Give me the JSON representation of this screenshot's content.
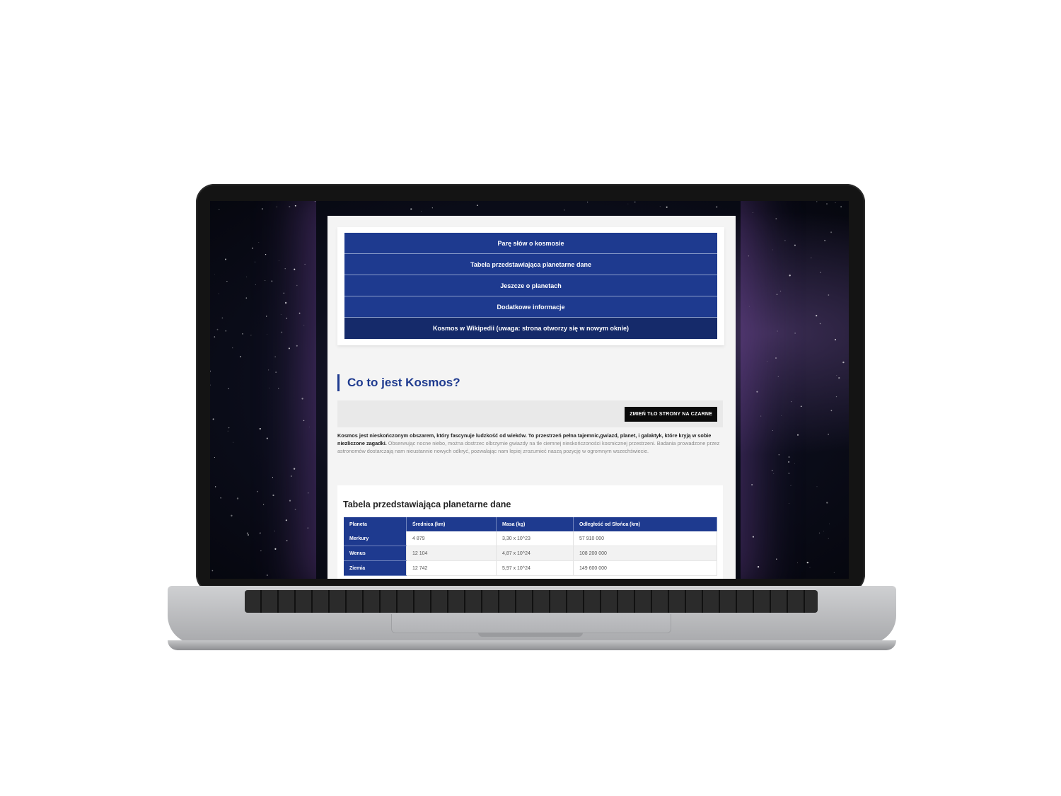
{
  "nav": {
    "items": [
      {
        "label": "Parę słów o kosmosie"
      },
      {
        "label": "Tabela przedstawiająca planetarne dane"
      },
      {
        "label": "Jeszcze o planetach"
      },
      {
        "label": "Dodatkowe informacje"
      },
      {
        "label": "Kosmos w Wikipedii (uwaga: strona otworzy się w nowym oknie)"
      }
    ]
  },
  "section": {
    "heading": "Co to jest Kosmos?",
    "bg_button": "ZMIEŃ TŁO STRONY NA CZARNE",
    "intro_bold": "Kosmos jest nieskończonym obszarem, który fascynuje ludzkość od wieków. To przestrzeń pełna tajemnic,gwiazd, planet, i galaktyk, które kryją w sobie niezliczone zagadki.",
    "intro_text": "Obserwując nocne niebo, można dostrzec olbrzymie gwiazdy na tle ciemnej nieskończoności kosmicznej przestrzeni. Badania prowadzone przez astronomów dostarczają nam nieustannie nowych odkryć, pozwalając nam lepiej zrozumieć naszą pozycję w ogromnym wszechświecie."
  },
  "table": {
    "title": "Tabela przedstawiająca planetarne dane",
    "headers": [
      "Planeta",
      "Średnica (km)",
      "Masa (kg)",
      "Odległość od Słońca (km)"
    ],
    "rows": [
      [
        "Merkury",
        "4 879",
        "3,30 x 10^23",
        "57 910 000"
      ],
      [
        "Wenus",
        "12 104",
        "4,87 x 10^24",
        "108 200 000"
      ],
      [
        "Ziemia",
        "12 742",
        "5,97 x 10^24",
        "149 600 000"
      ]
    ]
  },
  "colors": {
    "accent": "#1e3a8f",
    "nav_last": "#152a6a",
    "button": "#0a0a0a"
  }
}
